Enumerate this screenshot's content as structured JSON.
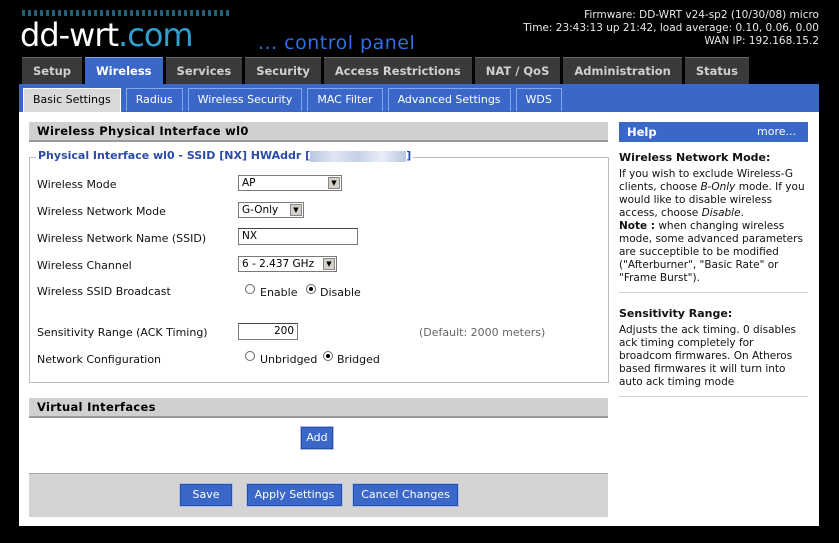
{
  "header": {
    "logo_main": "dd-wrt",
    "logo_suffix": ".com",
    "tagline": "... control panel",
    "firmware": "Firmware: DD-WRT v24-sp2 (10/30/08) micro",
    "time": "Time: 23:43:13 up 21:42, load average: 0.10, 0.06, 0.00",
    "wan_ip": "WAN IP: 192.168.15.2"
  },
  "main_tabs": [
    "Setup",
    "Wireless",
    "Services",
    "Security",
    "Access Restrictions",
    "NAT / QoS",
    "Administration",
    "Status"
  ],
  "sub_tabs": [
    "Basic Settings",
    "Radius",
    "Wireless Security",
    "MAC Filter",
    "Advanced Settings",
    "WDS"
  ],
  "section": {
    "title": "Wireless Physical Interface wl0",
    "legend": "Physical Interface wl0 - SSID [NX] HWAddr [",
    "legend_end": "]"
  },
  "form": {
    "wireless_mode_label": "Wireless Mode",
    "wireless_mode_value": "AP",
    "network_mode_label": "Wireless Network Mode",
    "network_mode_value": "G-Only",
    "ssid_label": "Wireless Network Name (SSID)",
    "ssid_value": "NX",
    "channel_label": "Wireless Channel",
    "channel_value": "6 - 2.437 GHz",
    "broadcast_label": "Wireless SSID Broadcast",
    "broadcast_enable": "Enable",
    "broadcast_disable": "Disable",
    "broadcast_selected": "Disable",
    "sensitivity_label": "Sensitivity Range (ACK Timing)",
    "sensitivity_value": "200",
    "sensitivity_hint": "(Default: 2000 meters)",
    "netconf_label": "Network Configuration",
    "netconf_unbridged": "Unbridged",
    "netconf_bridged": "Bridged",
    "netconf_selected": "Bridged"
  },
  "virtual": {
    "title": "Virtual Interfaces",
    "add_label": "Add"
  },
  "footer": {
    "save": "Save",
    "apply": "Apply Settings",
    "cancel": "Cancel Changes"
  },
  "help": {
    "title": "Help",
    "more": "more...",
    "h1": "Wireless Network Mode:",
    "p1a": "If you wish to exclude Wireless-G clients, choose ",
    "p1b": "B-Only",
    "p1c": " mode. If you would like to disable wireless access, choose ",
    "p1d": "Disable",
    "p1e": ".",
    "note_label": "Note :",
    "note_text": " when changing wireless mode, some advanced parameters are succeptible to be modified (\"Afterburner\", \"Basic Rate\" or \"Frame Burst\").",
    "h2": "Sensitivity Range:",
    "p2": "Adjusts the ack timing. 0 disables ack timing completely for broadcom firmwares. On Atheros based firmwares it will turn into auto ack timing mode"
  },
  "colors": {
    "accent_blue": "#3b67c8",
    "header_bg": "#000000",
    "section_gray": "#d0d0d0"
  }
}
